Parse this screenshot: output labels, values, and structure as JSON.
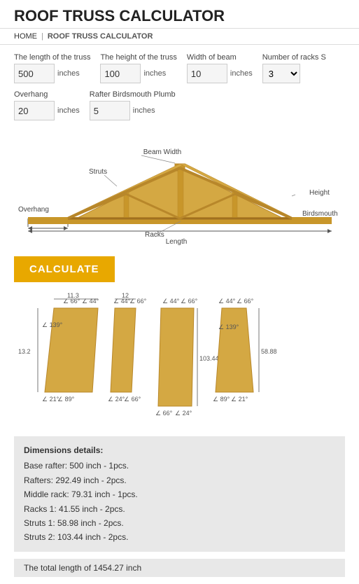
{
  "header": {
    "title": "ROOF TRUSS CALCULATOR"
  },
  "breadcrumb": {
    "home": "HOME",
    "separator": "|",
    "current": "ROOF TRUSS CALCULATOR"
  },
  "form": {
    "field1_label": "The length of the truss",
    "field1_value": "500",
    "field1_unit": "inches",
    "field2_label": "The height of the truss",
    "field2_value": "100",
    "field2_unit": "inches",
    "field3_label": "Width of beam",
    "field3_value": "10",
    "field3_unit": "inches",
    "field4_label": "Number of racks S",
    "field4_value": "3",
    "field5_label": "Overhang",
    "field5_value": "20",
    "field5_unit": "inches",
    "field6_label": "Rafter Birdsmouth Plumb",
    "field6_value": "5",
    "field6_unit": "inches"
  },
  "diagram": {
    "label_beam_width": "Beam Width",
    "label_struts": "Struts",
    "label_height": "Height",
    "label_overhang": "Overhang",
    "label_birdsmouth": "Birdsmouth",
    "label_racks": "Racks",
    "label_length": "Length"
  },
  "button": {
    "calculate": "CALCULATE"
  },
  "dimensions": {
    "title": "Dimensions details:",
    "base_rafter": "Base rafter: 500 inch - 1pcs.",
    "rafters": "Rafters: 292.49 inch - 2pcs.",
    "middle_rack": "Middle rack: 79.31 inch - 1pcs.",
    "racks1": "Racks 1: 41.55 inch - 2pcs.",
    "struts1": "Struts 1: 58.98 inch - 2pcs.",
    "struts2": "Struts 2: 103.44 inch - 2pcs.",
    "total": "The total length of 1454.27 inch"
  }
}
